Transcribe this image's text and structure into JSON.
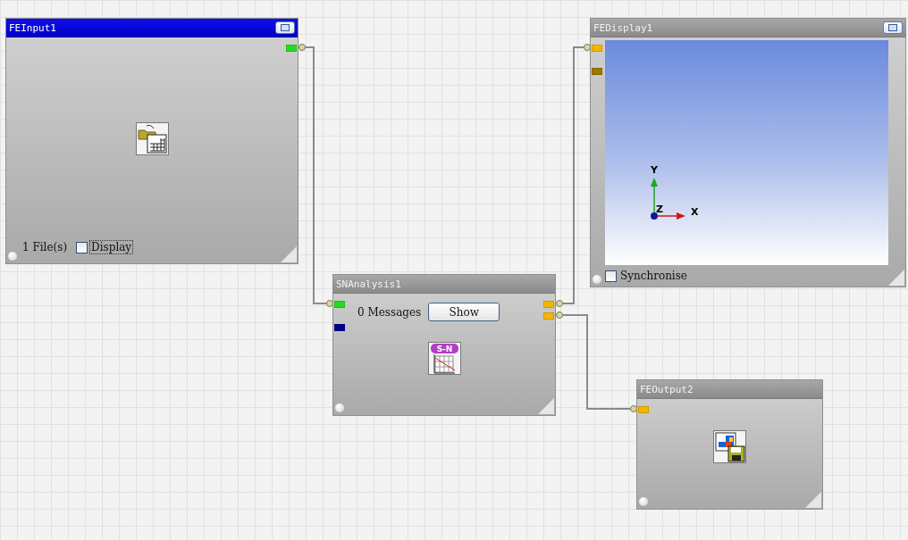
{
  "nodes": [
    {
      "kind": "input",
      "title": "FEInput1",
      "selected": true,
      "maximize": true,
      "outputs": [
        {
          "color": "#22dd22"
        }
      ],
      "status": "1 File(s)",
      "checkbox": {
        "label": "Display",
        "checked": false
      }
    },
    {
      "kind": "display",
      "title": "FEDisplay1",
      "selected": false,
      "maximize": true,
      "inputs": [
        {
          "color": "#f5b400"
        },
        {
          "color": "#a07800"
        }
      ],
      "axes": {
        "x": "X",
        "y": "Y",
        "z": "Z"
      },
      "checkbox": {
        "label": "Synchronise",
        "checked": false
      }
    },
    {
      "kind": "analysis",
      "title": "SNAnalysis1",
      "selected": false,
      "maximize": false,
      "inputs": [
        {
          "color": "#22dd22"
        },
        {
          "color": "#00008b"
        }
      ],
      "outputs": [
        {
          "color": "#f5b400"
        },
        {
          "color": "#f5b400"
        }
      ],
      "status": "0 Messages",
      "button": "Show",
      "icon_label": "S-N"
    },
    {
      "kind": "output",
      "title": "FEOutput2",
      "selected": false,
      "maximize": false,
      "inputs": [
        {
          "color": "#f5b400"
        }
      ]
    }
  ]
}
